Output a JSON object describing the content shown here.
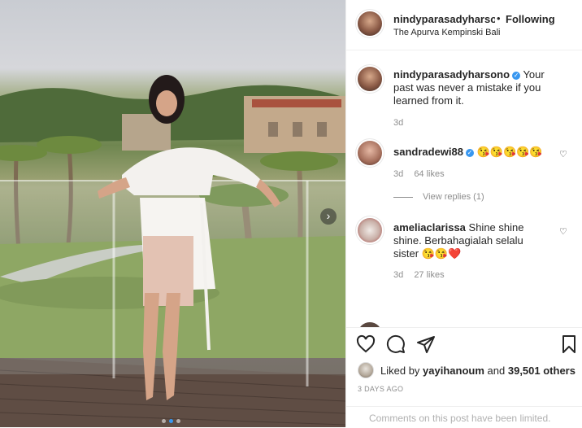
{
  "header": {
    "username": "nindyparasadyharsono",
    "separator": "•",
    "follow_status": "Following",
    "location": "The Apurva Kempinski Bali"
  },
  "caption": {
    "username": "nindyparasadyharsono",
    "text": "Your past was never a mistake if you learned from it.",
    "time": "3d"
  },
  "comments": [
    {
      "username": "sandradewi88",
      "verified": true,
      "text": "😘😘😘😘😘",
      "time": "3d",
      "likes": "64 likes",
      "replies": "View replies (1)"
    },
    {
      "username": "ameliaclarissa",
      "verified": false,
      "text": "Shine shine shine. Berbahagialah selalu sister 😘😘❤️",
      "time": "3d",
      "likes": "27 likes"
    }
  ],
  "actions": {
    "liked_prefix": "Liked by",
    "liked_user": "yayihanoum",
    "liked_conj": "and",
    "liked_count": "39,501 others",
    "date": "3 DAYS AGO",
    "comments_limited": "Comments on this post have been limited."
  },
  "carousel": {
    "next_icon": "chevron-right-icon",
    "dots": 3,
    "active_dot": 1
  },
  "colors": {
    "accent": "#3897f0",
    "text": "#262626",
    "muted": "#8e8e8e",
    "heart": "#ed4956"
  }
}
